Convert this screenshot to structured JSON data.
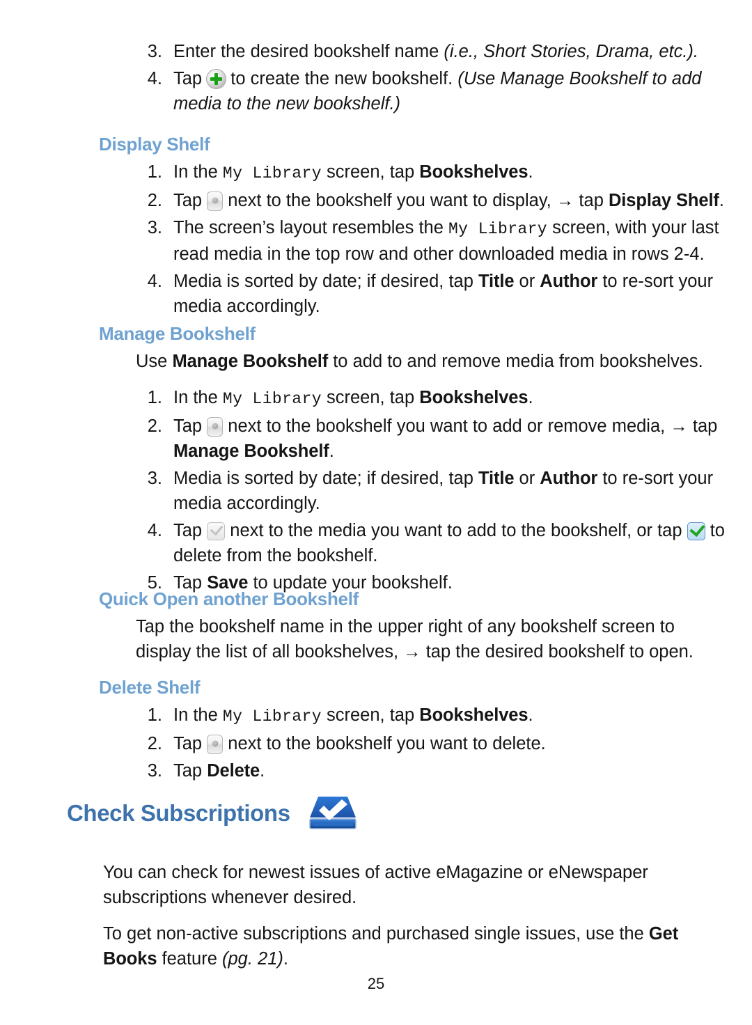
{
  "document": {
    "page_number": "25"
  },
  "top_steps": [
    {
      "num": "3.",
      "pre": "Enter the desired bookshelf name ",
      "italic": "(i.e., Short Stories, Drama, etc.).",
      "post": ""
    },
    {
      "num": "4.",
      "pre": "Tap ",
      "icon": "plus-circle-icon",
      "mid": " to create the new bookshelf. ",
      "italic": "(Use Manage Bookshelf to add media to the new bookshelf.)",
      "post": ""
    }
  ],
  "display_shelf": {
    "heading": "Display Shelf",
    "steps": [
      {
        "num": "1.",
        "a": "In the ",
        "mono": "My Library",
        "b": " screen, tap ",
        "bold": "Bookshelves",
        "c": "."
      },
      {
        "num": "2.",
        "a": "Tap ",
        "icon": "shelf-menu-icon",
        "b": " next to the bookshelf you want to display, → tap ",
        "bold": "Display Shelf",
        "c": "."
      },
      {
        "num": "3.",
        "a": "The screen’s layout resembles the ",
        "mono": "My Library",
        "b": " screen, with your last read media in the top row and other downloaded media in rows 2-4.",
        "bold": "",
        "c": ""
      },
      {
        "num": "4.",
        "a": "Media is sorted by date; if desired, tap ",
        "bold1": "Title",
        "b": " or ",
        "bold2": "Author",
        "c": " to re-sort your media accordingly."
      }
    ]
  },
  "manage_bookshelf": {
    "heading": "Manage Bookshelf",
    "intro": {
      "a": "Use ",
      "bold": "Manage Bookshelf",
      "b": " to add to and remove media from bookshelves."
    },
    "steps": [
      {
        "num": "1.",
        "a": "In the ",
        "mono": "My Library",
        "b": " screen, tap ",
        "bold": "Bookshelves",
        "c": "."
      },
      {
        "num": "2.",
        "a": "Tap ",
        "icon": "shelf-menu-icon",
        "b": " next to the bookshelf you want to add or remove media, → tap ",
        "bold": "Manage Bookshelf",
        "c": "."
      },
      {
        "num": "3.",
        "a": "Media is sorted by date; if desired, tap ",
        "bold1": "Title",
        "b": " or ",
        "bold2": "Author",
        "c": " to re-sort your media accordingly."
      },
      {
        "num": "4.",
        "a": "Tap ",
        "icon1": "checkbox-grey-icon",
        "b": " next to the media you want to add to the bookshelf, or tap ",
        "icon2": "checkbox-checked-icon",
        "c": " to delete from the bookshelf."
      },
      {
        "num": "5.",
        "a": "Tap ",
        "bold": "Save",
        "b": " to update your bookshelf.",
        "c": ""
      }
    ]
  },
  "quick_open": {
    "heading": "Quick Open another Bookshelf",
    "body": "Tap the bookshelf name in the upper right of any bookshelf screen to display the list of all bookshelves, → tap the desired bookshelf to open."
  },
  "delete_shelf": {
    "heading": "Delete Shelf",
    "steps": [
      {
        "num": "1.",
        "a": "In the ",
        "mono": "My Library",
        "b": " screen, tap ",
        "bold": "Bookshelves",
        "c": "."
      },
      {
        "num": "2.",
        "a": "Tap ",
        "icon": "shelf-menu-icon",
        "b": " next to the bookshelf you want to delete.",
        "bold": "",
        "c": ""
      },
      {
        "num": "3.",
        "a": "Tap ",
        "bold": "Delete",
        "b": ".",
        "c": ""
      }
    ]
  },
  "check_subscriptions": {
    "heading": "Check Subscriptions",
    "icon": "check-drive-icon",
    "para1": "You can check for newest issues of active eMagazine or eNewspaper subscriptions whenever desired.",
    "para2": {
      "a": "To get non-active subscriptions and purchased single issues, use the ",
      "bold": "Get Books",
      "b": " feature ",
      "italic": "(pg. 21)",
      "c": "."
    }
  },
  "colors": {
    "subheading_blue": "#6FA2D0",
    "heading_blue": "#3E72AC",
    "body_text": "#151515",
    "icon_green": "#18A018",
    "icon_blue": "#1F5FBE"
  }
}
